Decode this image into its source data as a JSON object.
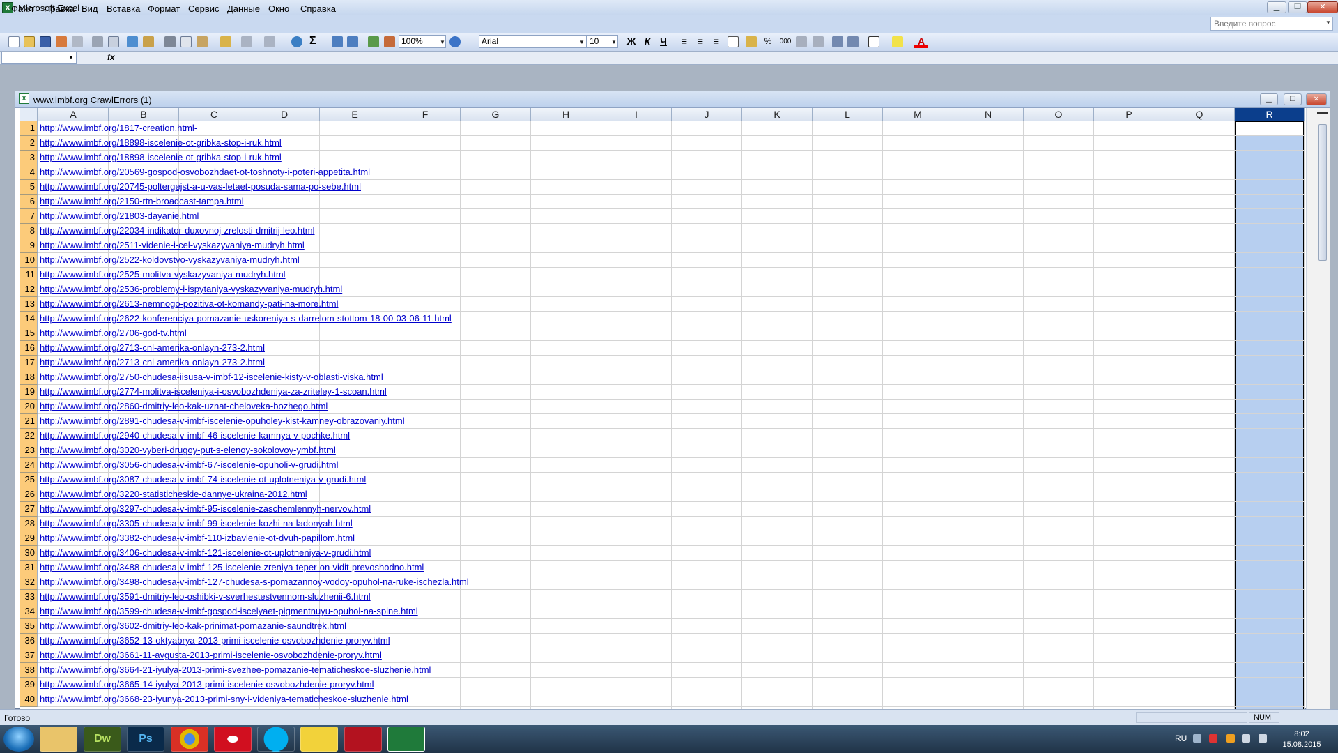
{
  "app": {
    "title": "Microsoft Excel"
  },
  "menu": [
    "Файл",
    "Правка",
    "Вид",
    "Вставка",
    "Формат",
    "Сервис",
    "Данные",
    "Окно",
    "Справка"
  ],
  "help_placeholder": "Введите вопрос",
  "toolbar": {
    "zoom": "100%",
    "font": "Arial",
    "font_size": "10",
    "bold": "Ж",
    "italic": "К",
    "underline": "Ч",
    "percent": "%",
    "thousands": "000"
  },
  "formula": {
    "fx": "fx"
  },
  "workbook": {
    "title": "www.imbf.org CrawlErrors (1)"
  },
  "columns": [
    "A",
    "B",
    "C",
    "D",
    "E",
    "F",
    "G",
    "H",
    "I",
    "J",
    "K",
    "L",
    "M",
    "N",
    "O",
    "P",
    "Q",
    "R"
  ],
  "selected_column": "R",
  "rows": [
    {
      "n": "1",
      "a": "http://www.imbf.org/1817-creation.html-"
    },
    {
      "n": "2",
      "a": "http://www.imbf.org/18898-iscelenie-ot-gribka-stop-i-ruk.html"
    },
    {
      "n": "3",
      "a": "http://www.imbf.org/18898-iscelenie-ot-gribka-stop-i-ruk.html"
    },
    {
      "n": "4",
      "a": "http://www.imbf.org/20569-gospod-osvobozhdaet-ot-toshnoty-i-poteri-appetita.html"
    },
    {
      "n": "5",
      "a": "http://www.imbf.org/20745-poltergejst-a-u-vas-letaet-posuda-sama-po-sebe.html"
    },
    {
      "n": "6",
      "a": "http://www.imbf.org/2150-rtn-broadcast-tampa.html"
    },
    {
      "n": "7",
      "a": "http://www.imbf.org/21803-dayanie.html"
    },
    {
      "n": "8",
      "a": "http://www.imbf.org/22034-indikator-duxovnoj-zrelosti-dmitrij-leo.html"
    },
    {
      "n": "9",
      "a": "http://www.imbf.org/2511-videnie-i-cel-vyskazyvaniya-mudryh.html"
    },
    {
      "n": "10",
      "a": "http://www.imbf.org/2522-koldovstvo-vyskazyvaniya-mudryh.html"
    },
    {
      "n": "11",
      "a": "http://www.imbf.org/2525-molitva-vyskazyvaniya-mudryh.html"
    },
    {
      "n": "12",
      "a": "http://www.imbf.org/2536-problemy-i-ispytaniya-vyskazyvaniya-mudryh.html"
    },
    {
      "n": "13",
      "a": "http://www.imbf.org/2613-nemnogo-pozitiva-ot-komandy-pati-na-more.html"
    },
    {
      "n": "14",
      "a": "http://www.imbf.org/2622-konferenciya-pomazanie-uskoreniya-s-darrelom-stottom-18-00-03-06-11.html"
    },
    {
      "n": "15",
      "a": "http://www.imbf.org/2706-god-tv.html"
    },
    {
      "n": "16",
      "a": "http://www.imbf.org/2713-cnl-amerika-onlayn-273-2.html"
    },
    {
      "n": "17",
      "a": "http://www.imbf.org/2713-cnl-amerika-onlayn-273-2.html"
    },
    {
      "n": "18",
      "a": "http://www.imbf.org/2750-chudesa-iisusa-v-imbf-12-iscelenie-kisty-v-oblasti-viska.html"
    },
    {
      "n": "19",
      "a": "http://www.imbf.org/2774-molitva-isceleniya-i-osvobozhdeniya-za-zriteley-1-scoan.html"
    },
    {
      "n": "20",
      "a": "http://www.imbf.org/2860-dmitriy-leo-kak-uznat-cheloveka-bozhego.html"
    },
    {
      "n": "21",
      "a": "http://www.imbf.org/2891-chudesa-v-imbf-iscelenie-opuholey-kist-kamney-obrazovaniy.html"
    },
    {
      "n": "22",
      "a": "http://www.imbf.org/2940-chudesa-v-imbf-46-iscelenie-kamnya-v-pochke.html"
    },
    {
      "n": "23",
      "a": "http://www.imbf.org/3020-vyberi-drugoy-put-s-elenoy-sokolovoy-ymbf.html"
    },
    {
      "n": "24",
      "a": "http://www.imbf.org/3056-chudesa-v-imbf-67-iscelenie-opuholi-v-grudi.html"
    },
    {
      "n": "25",
      "a": "http://www.imbf.org/3087-chudesa-v-imbf-74-iscelenie-ot-uplotneniya-v-grudi.html"
    },
    {
      "n": "26",
      "a": "http://www.imbf.org/3220-statisticheskie-dannye-ukraina-2012.html"
    },
    {
      "n": "27",
      "a": "http://www.imbf.org/3297-chudesa-v-imbf-95-iscelenie-zaschemlennyh-nervov.html"
    },
    {
      "n": "28",
      "a": "http://www.imbf.org/3305-chudesa-v-imbf-99-iscelenie-kozhi-na-ladonyah.html"
    },
    {
      "n": "29",
      "a": "http://www.imbf.org/3382-chudesa-v-imbf-110-izbavlenie-ot-dvuh-papillom.html"
    },
    {
      "n": "30",
      "a": "http://www.imbf.org/3406-chudesa-v-imbf-121-iscelenie-ot-uplotneniya-v-grudi.html"
    },
    {
      "n": "31",
      "a": "http://www.imbf.org/3488-chudesa-v-imbf-125-iscelenie-zreniya-teper-on-vidit-prevoshodno.html"
    },
    {
      "n": "32",
      "a": "http://www.imbf.org/3498-chudesa-v-imbf-127-chudesa-s-pomazannoy-vodoy-opuhol-na-ruke-ischezla.html"
    },
    {
      "n": "33",
      "a": "http://www.imbf.org/3591-dmitriy-leo-oshibki-v-sverhestestvennom-sluzhenii-6.html"
    },
    {
      "n": "34",
      "a": "http://www.imbf.org/3599-chudesa-v-imbf-gospod-iscelyaet-pigmentnuyu-opuhol-na-spine.html"
    },
    {
      "n": "35",
      "a": "http://www.imbf.org/3602-dmitriy-leo-kak-prinimat-pomazanie-saundtrek.html"
    },
    {
      "n": "36",
      "a": "http://www.imbf.org/3652-13-oktyabrya-2013-primi-iscelenie-osvobozhdenie-proryv.html"
    },
    {
      "n": "37",
      "a": "http://www.imbf.org/3661-11-avgusta-2013-primi-iscelenie-osvobozhdenie-proryv.html"
    },
    {
      "n": "38",
      "a": "http://www.imbf.org/3664-21-iyulya-2013-primi-svezhee-pomazanie-tematicheskoe-sluzhenie.html"
    },
    {
      "n": "39",
      "a": "http://www.imbf.org/3665-14-iyulya-2013-primi-iscelenie-osvobozhdenie-proryv.html"
    },
    {
      "n": "40",
      "a": "http://www.imbf.org/3668-23-iyunya-2013-primi-sny-i-videniya-tematicheskoe-sluzhenie.html"
    }
  ],
  "status": {
    "text": "Готово",
    "num": "NUM"
  },
  "taskbar": {
    "dw": "Dw",
    "ps": "Ps",
    "lang": "RU",
    "time": "8:02",
    "date": "15.08.2015"
  },
  "colors": {
    "link": "#0000cc",
    "row_header": "#fccb7a",
    "selected_col_header": "#0b3e8c"
  }
}
